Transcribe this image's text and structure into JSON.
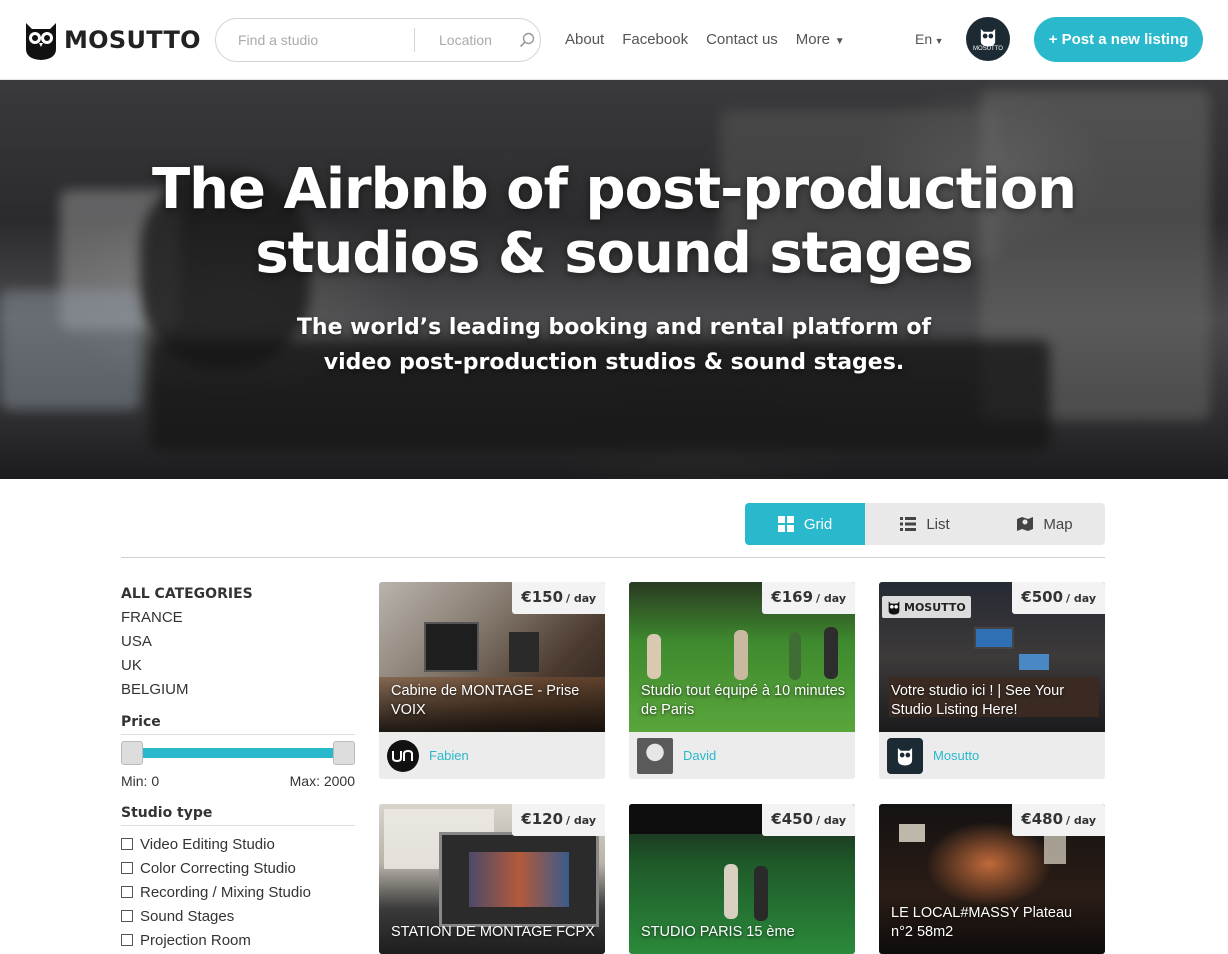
{
  "header": {
    "logo_text": "MOSUTTO",
    "search_placeholder": "Find a studio",
    "location_placeholder": "Location",
    "nav": [
      "About",
      "Facebook",
      "Contact us",
      "More"
    ],
    "language": "En",
    "post_button": "+ Post a new listing",
    "avatar_text": "MOSUTTO"
  },
  "hero": {
    "title_line1": "The Airbnb of post-production",
    "title_line2": "studios & sound stages",
    "subtitle_line1": "The world’s leading booking and rental platform of",
    "subtitle_line2": "video post-production studios & sound stages."
  },
  "view_toggle": {
    "active": "Grid",
    "options": [
      "Grid",
      "List",
      "Map"
    ]
  },
  "sidebar": {
    "categories_title": "ALL CATEGORIES",
    "categories": [
      "FRANCE",
      "USA",
      "UK",
      "BELGIUM"
    ],
    "price_title": "Price",
    "price_min_label": "Min: 0",
    "price_max_label": "Max: 2000",
    "price_range_fraction": [
      0,
      1
    ],
    "studio_type_title": "Studio type",
    "studio_types": [
      "Video Editing Studio",
      "Color Correcting Studio",
      "Recording / Mixing Studio",
      "Sound Stages",
      "Projection Room"
    ]
  },
  "listings": [
    {
      "price": "€150",
      "per": "/ day",
      "title": "Cabine de MONTAGE - Prise VOIX",
      "owner": "Fabien"
    },
    {
      "price": "€169",
      "per": "/ day",
      "title": "Studio tout équipé à 10 minutes de Paris",
      "owner": "David"
    },
    {
      "price": "€500",
      "per": "/ day",
      "title": "Votre studio ici ! | See Your Studio Listing Here!",
      "owner": "Mosutto",
      "badge": "MOSUTTO"
    },
    {
      "price": "€120",
      "per": "/ day",
      "title": "STATION DE MONTAGE FCPX"
    },
    {
      "price": "€450",
      "per": "/ day",
      "title": "STUDIO PARIS 15 ème"
    },
    {
      "price": "€480",
      "per": "/ day",
      "title": "LE LOCAL#MASSY Plateau n°2 58m2"
    }
  ],
  "colors": {
    "accent": "#29b8cc"
  }
}
